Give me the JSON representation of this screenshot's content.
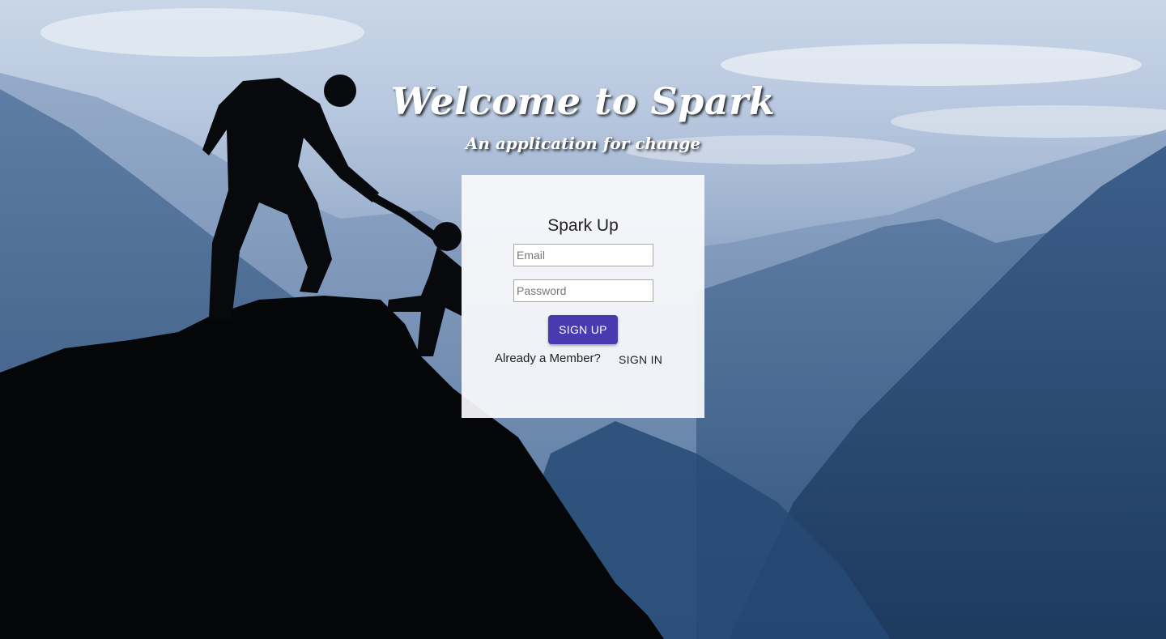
{
  "hero": {
    "title": "Welcome to Spark",
    "subtitle": "An application for change"
  },
  "form": {
    "title": "Spark Up",
    "email": {
      "value": "",
      "placeholder": "Email"
    },
    "password": {
      "value": "",
      "placeholder": "Password"
    },
    "submit_label": "SIGN UP",
    "member_prompt": "Already a Member?",
    "signin_label": "SIGN IN"
  },
  "colors": {
    "primary_button": "#4a3ab0",
    "card_background": "#f8f8fa",
    "hero_text": "#ffffff"
  },
  "background": {
    "icon": "mountain-climbers-silhouette"
  }
}
